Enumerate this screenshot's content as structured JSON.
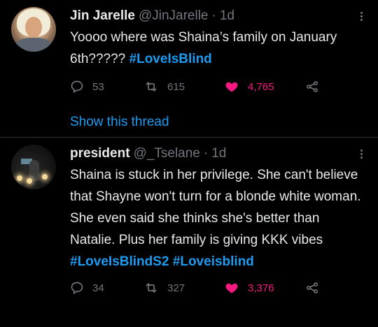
{
  "tweets": [
    {
      "name": "Jin Jarelle",
      "handle": "@JinJarelle",
      "separator": "·",
      "time": "1d",
      "text": "Yoooo where was Shaina’s family on January 6th????? ",
      "hashtags": [
        "#LoveIsBlind"
      ],
      "replies": "53",
      "retweets": "615",
      "likes": "4,765",
      "show_thread": "Show this thread"
    },
    {
      "name": "president",
      "handle": "@_Tselane",
      "separator": "·",
      "time": "1d",
      "text": "Shaina is stuck in her privilege. She can't believe that Shayne won't turn for a blonde white woman. She even said she thinks she's better than Natalie. Plus her family is giving KKK vibes",
      "hashtags": [
        "#LoveIsBlindS2",
        "#Loveisblind"
      ],
      "replies": "34",
      "retweets": "327",
      "likes": "3,376"
    }
  ],
  "colors": {
    "background": "#000000",
    "text": "#e7e9ea",
    "muted": "#71767b",
    "accent": "#1d9bf0",
    "like": "#f91880",
    "divider": "#2f3336"
  },
  "icons": {
    "reply": "reply-icon",
    "retweet": "retweet-icon",
    "like": "heart-icon",
    "share": "share-icon",
    "more": "more-icon"
  }
}
